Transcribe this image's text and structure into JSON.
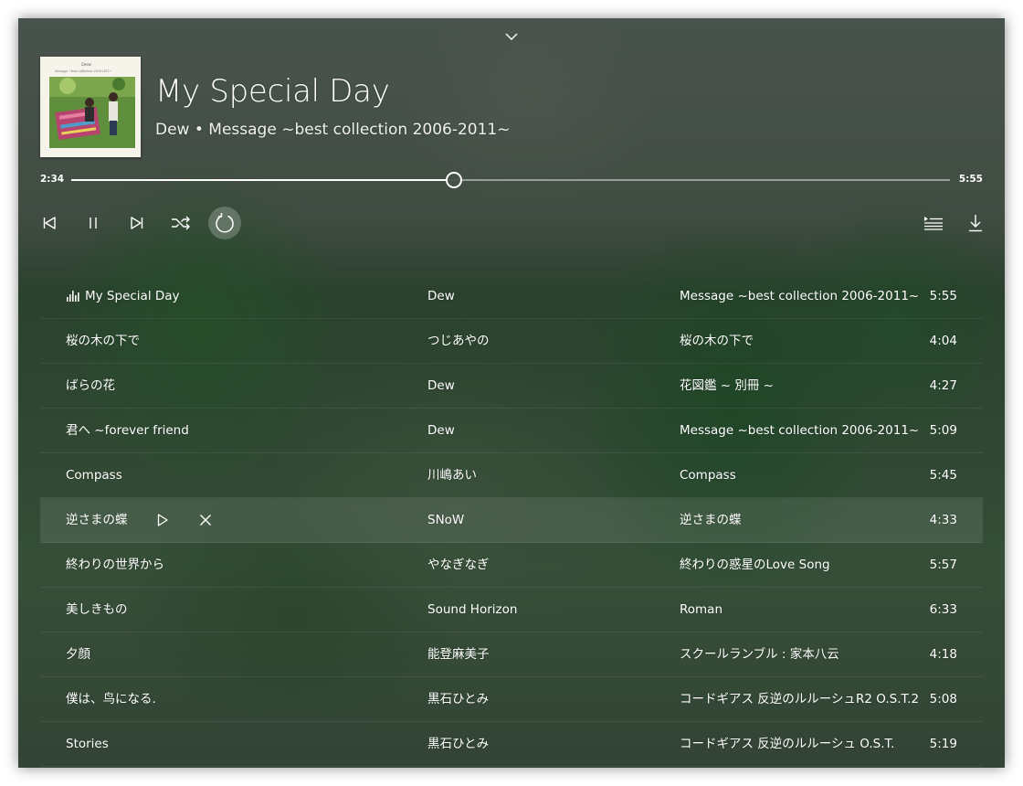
{
  "now_playing": {
    "title": "My Special Day",
    "subtitle": "Dew • Message ~best collection 2006-2011~",
    "album_art": {
      "artist_text": "Dew",
      "album_text": "Message ~best collection 2006-2011~"
    }
  },
  "progress": {
    "current": "2:34",
    "duration": "5:55",
    "fraction": 0.434
  },
  "controls": {
    "previous": "previous-icon",
    "pause": "pause-icon",
    "next": "next-icon",
    "shuffle": "shuffle-icon",
    "repeat": "repeat-icon",
    "repeat_active": true,
    "queue": "queue-icon",
    "download": "download-icon"
  },
  "tracks": [
    {
      "title": "My Special Day",
      "artist": "Dew",
      "album": "Message ~best collection 2006-2011~",
      "duration": "5:55",
      "playing": true
    },
    {
      "title": "桜の木の下で",
      "artist": "つじあやの",
      "album": "桜の木の下で",
      "duration": "4:04"
    },
    {
      "title": "ばらの花",
      "artist": "Dew",
      "album": "花図鑑 ~ 別冊 ~",
      "duration": "4:27"
    },
    {
      "title": "君へ ~forever friend",
      "artist": "Dew",
      "album": "Message ~best collection 2006-2011~",
      "duration": "5:09"
    },
    {
      "title": "Compass",
      "artist": "川嶋あい",
      "album": "Compass",
      "duration": "5:45"
    },
    {
      "title": "逆さまの蝶",
      "artist": "SNoW",
      "album": "逆さまの蝶",
      "duration": "4:33",
      "hovered": true
    },
    {
      "title": "終わりの世界から",
      "artist": "やなぎなぎ",
      "album": "終わりの惑星のLove Song",
      "duration": "5:57"
    },
    {
      "title": "美しきもの",
      "artist": "Sound Horizon",
      "album": "Roman",
      "duration": "6:33"
    },
    {
      "title": "夕顔",
      "artist": "能登麻美子",
      "album": "スクールランブル : 家本八云",
      "duration": "4:18"
    },
    {
      "title": "僕は、鸟になる.",
      "artist": "黒石ひとみ",
      "album": "コードギアス 反逆のルルーシュR2 O.S.T.2",
      "duration": "5:08"
    },
    {
      "title": "Stories",
      "artist": "黒石ひとみ",
      "album": "コードギアス 反逆のルルーシュ O.S.T.",
      "duration": "5:19"
    }
  ]
}
